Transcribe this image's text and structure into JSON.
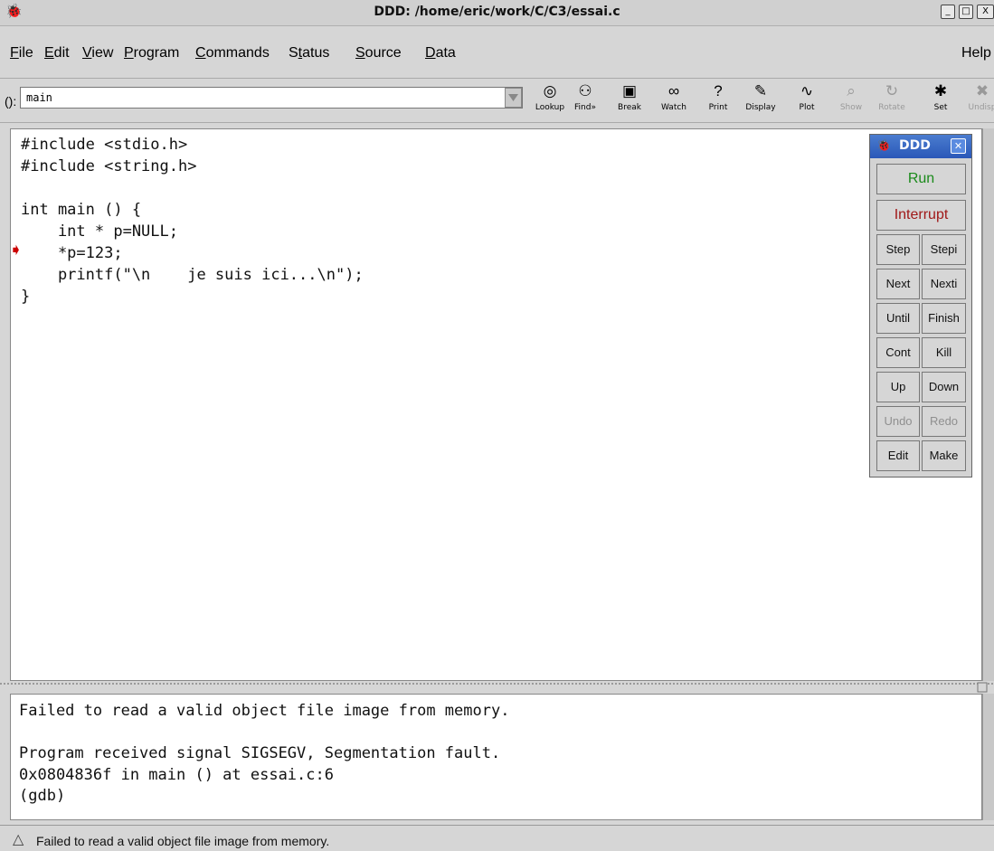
{
  "window": {
    "title": "DDD: /home/eric/work/C/C3/essai.c",
    "buttons": [
      "_",
      "□",
      "X"
    ]
  },
  "menubar": {
    "items": [
      {
        "label": "File",
        "mnemonic": "F"
      },
      {
        "label": "Edit",
        "mnemonic": "E"
      },
      {
        "label": "View",
        "mnemonic": "V"
      },
      {
        "label": "Program",
        "mnemonic": "P"
      },
      {
        "label": "Commands",
        "mnemonic": "C"
      },
      {
        "label": "Status",
        "mnemonic": "t"
      },
      {
        "label": "Source",
        "mnemonic": "S"
      },
      {
        "label": "Data",
        "mnemonic": "D"
      }
    ],
    "help": "Help"
  },
  "toolbar": {
    "arg_label": "():",
    "arg_value": "main",
    "buttons": [
      {
        "label": "Lookup",
        "icon": "lookup-icon",
        "glyph": "◎",
        "enabled": true
      },
      {
        "label": "Find»",
        "icon": "binoculars-icon",
        "glyph": "⚇",
        "enabled": true
      },
      {
        "label": "Break",
        "icon": "stop-icon",
        "glyph": "▣",
        "enabled": true
      },
      {
        "label": "Watch",
        "icon": "glasses-icon",
        "glyph": "∞",
        "enabled": true
      },
      {
        "label": "Print",
        "icon": "question-icon",
        "glyph": "?",
        "enabled": true
      },
      {
        "label": "Display",
        "icon": "display-icon",
        "glyph": "✎",
        "enabled": true
      },
      {
        "label": "Plot",
        "icon": "plot-icon",
        "glyph": "∿",
        "enabled": true
      },
      {
        "label": "Show",
        "icon": "magnifier-icon",
        "glyph": "⌕",
        "enabled": false
      },
      {
        "label": "Rotate",
        "icon": "rotate-icon",
        "glyph": "↻",
        "enabled": false
      },
      {
        "label": "Set",
        "icon": "set-icon",
        "glyph": "✱",
        "enabled": true
      },
      {
        "label": "Undisp",
        "icon": "undisplay-icon",
        "glyph": "✖",
        "enabled": false
      }
    ]
  },
  "source": {
    "lines": [
      "#include <stdio.h>",
      "#include <string.h>",
      "",
      "int main () {",
      "    int * p=NULL;",
      "    *p=123;",
      "    printf(\"\\n    je suis ici...\\n\");",
      "}"
    ],
    "current_line_index": 5
  },
  "console": {
    "lines": [
      "Failed to read a valid object file image from memory.",
      "",
      "Program received signal SIGSEGV, Segmentation fault.",
      "0x0804836f in main () at essai.c:6",
      "(gdb)"
    ]
  },
  "status": {
    "text": "Failed to read a valid object file image from memory."
  },
  "palette": {
    "title": "DDD",
    "run": "Run",
    "interrupt": "Interrupt",
    "rows": [
      [
        "Step",
        "Stepi"
      ],
      [
        "Next",
        "Nexti"
      ],
      [
        "Until",
        "Finish"
      ],
      [
        "Cont",
        "Kill"
      ],
      [
        "Up",
        "Down"
      ],
      [
        "Undo",
        "Redo"
      ],
      [
        "Edit",
        "Make"
      ]
    ],
    "disabled": [
      "Undo",
      "Redo"
    ],
    "colors": {
      "run": "#1a8a1a",
      "interrupt": "#a01818",
      "disabled": "#8f8f8f"
    }
  }
}
